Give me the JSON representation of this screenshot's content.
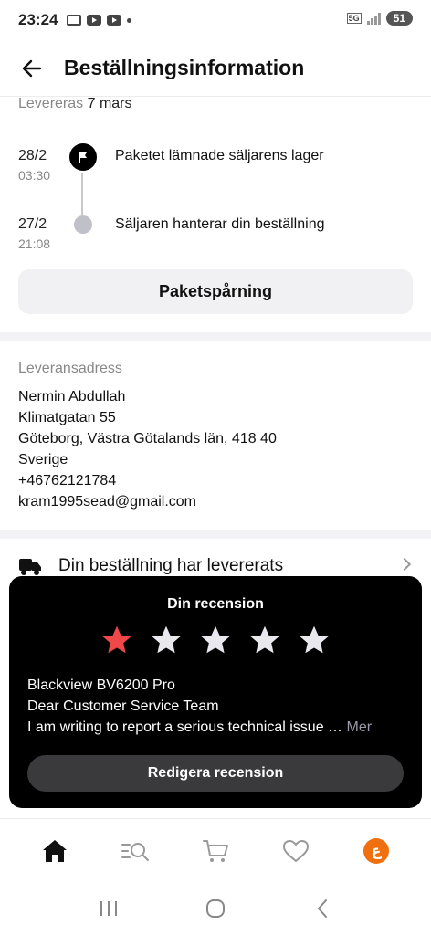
{
  "status_bar": {
    "time": "23:24",
    "network": "5G",
    "battery": "51"
  },
  "header": {
    "title": "Beställningsinformation"
  },
  "delivery": {
    "label": "Levereras",
    "date": "7 mars"
  },
  "timeline": [
    {
      "date": "28/2",
      "time": "03:30",
      "text": "Paketet lämnade säljarens lager"
    },
    {
      "date": "27/2",
      "time": "21:08",
      "text": "Säljaren hanterar din beställning"
    }
  ],
  "tracking_button": "Paketspårning",
  "address": {
    "label": "Leveransadress",
    "lines": [
      "Nermin Abdullah",
      "Klimatgatan 55",
      "Göteborg, Västra Götalands län, 418 40",
      "Sverige",
      "+46762121784",
      "kram1995sead@gmail.com"
    ]
  },
  "delivered_status": "Din beställning har levererats",
  "review": {
    "title": "Din recension",
    "rating": 1,
    "max_rating": 5,
    "star_active_color": "#f04848",
    "star_inactive_color": "#e8e8ee",
    "product": "Blackview BV6200 Pro",
    "line1": "Dear Customer Service Team",
    "line2": "I am writing to report a serious technical issue …",
    "more": "Mer",
    "edit_button": "Redigera recension"
  },
  "bottom_nav": {
    "items": [
      "home-icon",
      "search-list-icon",
      "cart-icon",
      "heart-icon",
      "avatar"
    ],
    "avatar_letter": "ع"
  },
  "colors": {
    "accent": "#f07010",
    "background": "#ffffff",
    "popup": "#000000"
  }
}
